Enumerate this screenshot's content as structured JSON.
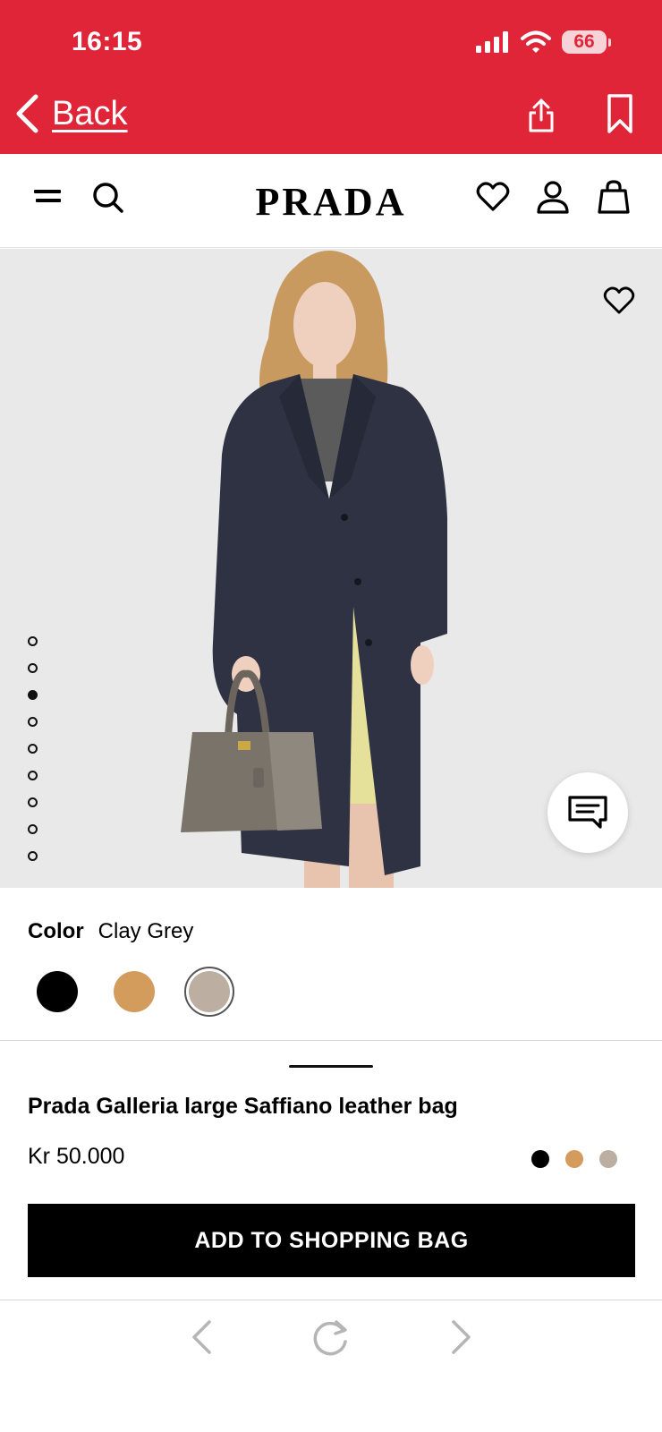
{
  "status_bar": {
    "time": "16:15",
    "battery": "66"
  },
  "browser_bar": {
    "back_label": "Back"
  },
  "brand": {
    "logo_text": "PRADA"
  },
  "gallery": {
    "image_count": 9,
    "active_index": 2
  },
  "product": {
    "color_label": "Color",
    "color_value": "Clay Grey",
    "colors": [
      {
        "name": "black",
        "hex": "#000000",
        "selected": false
      },
      {
        "name": "caramel",
        "hex": "#d39b5c",
        "selected": false
      },
      {
        "name": "clay-grey",
        "hex": "#bcaea1",
        "selected": true
      }
    ],
    "name": "Prada Galleria large Saffiano leather bag",
    "price": "Kr 50.000",
    "add_to_bag_label": "ADD TO SHOPPING BAG"
  },
  "theme": {
    "browser_bar_color": "#e02538",
    "accent": "#000000"
  }
}
